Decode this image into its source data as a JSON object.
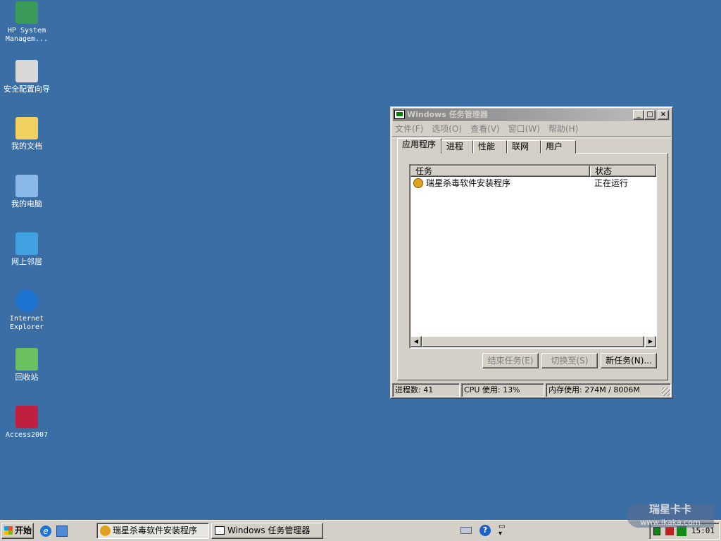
{
  "desktop": {
    "icons": [
      {
        "label": "HP System Managem...",
        "icon": "hp-system-management-icon"
      },
      {
        "label": "安全配置向导",
        "icon": "security-wizard-icon"
      },
      {
        "label": "我的文档",
        "icon": "my-documents-icon"
      },
      {
        "label": "我的电脑",
        "icon": "my-computer-icon"
      },
      {
        "label": "网上邻居",
        "icon": "network-places-icon"
      },
      {
        "label": "Internet Explorer",
        "icon": "internet-explorer-icon"
      },
      {
        "label": "回收站",
        "icon": "recycle-bin-icon"
      },
      {
        "label": "Access2007",
        "icon": "access-icon"
      }
    ]
  },
  "window": {
    "title": "Windows 任务管理器",
    "menu": [
      "文件(F)",
      "选项(O)",
      "查看(V)",
      "窗口(W)",
      "帮助(H)"
    ],
    "tabs": [
      "应用程序",
      "进程",
      "性能",
      "联网",
      "用户"
    ],
    "columns": [
      "任务",
      "状态"
    ],
    "rows": [
      {
        "task": "瑞星杀毒软件安装程序",
        "status": "正在运行"
      }
    ],
    "buttons": {
      "end": "结束任务(E)",
      "switch": "切换至(S)",
      "new": "新任务(N)..."
    },
    "status": {
      "processes": "进程数: 41",
      "cpu": "CPU 使用: 13%",
      "memory": "内存使用: 274M / 8006M"
    }
  },
  "taskbar": {
    "start": "开始",
    "items": [
      "瑞星杀毒软件安装程序",
      "Windows 任务管理器"
    ],
    "clock": "15:01"
  },
  "watermark": {
    "title": "瑞星卡卡",
    "url": "www.ikaka.com"
  }
}
